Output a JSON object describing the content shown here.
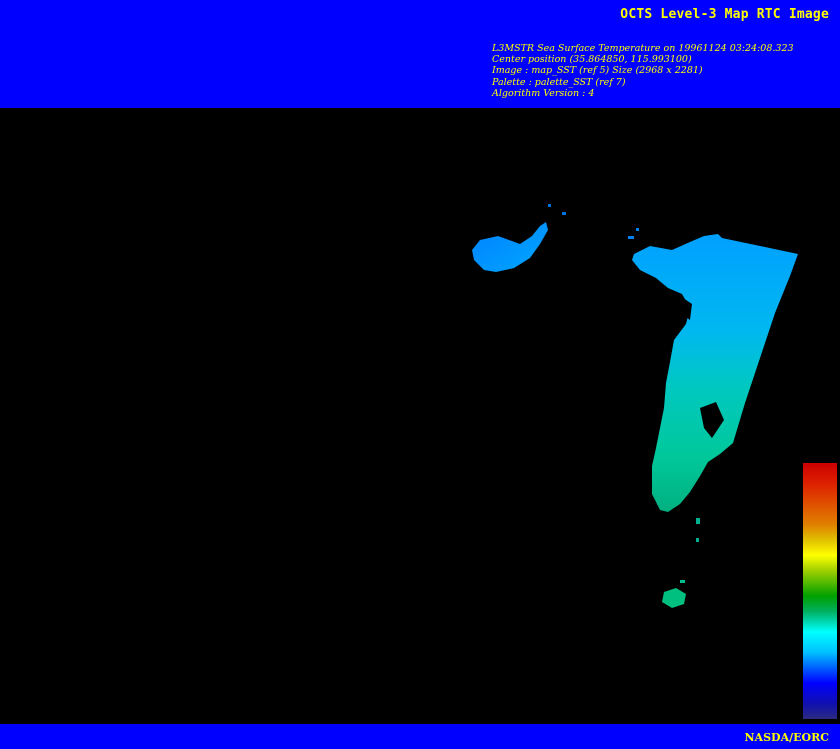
{
  "header": {
    "title": "OCTS Level-3 Map RTC Image",
    "lines": [
      "L3MSTR Sea Surface Temperature on 19961124 03:24:08.323",
      "Center position (35.864850, 115.993100)",
      "Image : map_SST (ref 5) Size (2968 x 2281)",
      "Palette : palette_SST (ref 7)",
      "Algorithm Version : 4"
    ]
  },
  "footer": {
    "credit": "NASDA/EORC"
  },
  "colors": {
    "banner": "#0000ff",
    "text": "#ffff00",
    "background": "#000000",
    "sst_warm": "#00d0a0",
    "sst_cool": "#00a0ff"
  },
  "colorbar": {
    "palette": [
      "#cc0000",
      "#e08000",
      "#ffff00",
      "#00a000",
      "#00ffff",
      "#0060ff",
      "#0000ff",
      "#2a2a80"
    ]
  }
}
